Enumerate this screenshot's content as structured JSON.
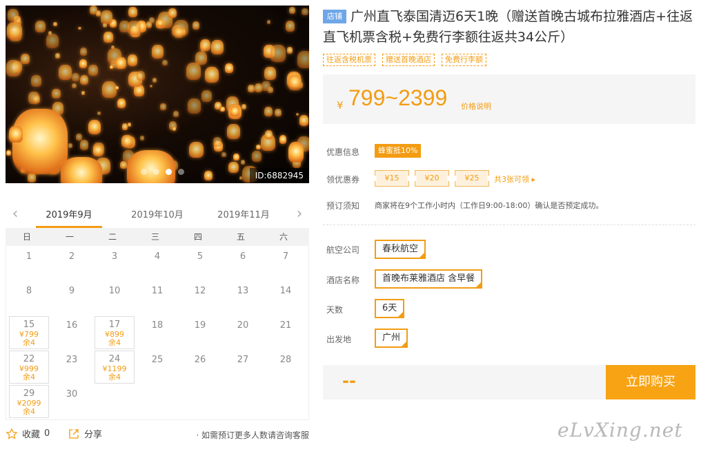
{
  "gallery": {
    "image_id": "ID:6882945",
    "dot_count": 4,
    "active_dot": 2
  },
  "calendar": {
    "prev_icon": "chevron-left-icon",
    "next_icon": "chevron-right-icon",
    "months": [
      "2019年9月",
      "2019年10月",
      "2019年11月"
    ],
    "active_month": 0,
    "weekdays": [
      "日",
      "一",
      "二",
      "三",
      "四",
      "五",
      "六"
    ],
    "start_weekday": 0,
    "days_in_month": 30,
    "available": [
      {
        "day": "15",
        "price": "¥799",
        "stock": "余4"
      },
      {
        "day": "17",
        "price": "¥899",
        "stock": "余4"
      },
      {
        "day": "22",
        "price": "¥999",
        "stock": "余4"
      },
      {
        "day": "24",
        "price": "¥1199",
        "stock": "余4"
      },
      {
        "day": "29",
        "price": "¥2099",
        "stock": "余4"
      }
    ]
  },
  "actions": {
    "favorite_label": "收藏",
    "favorite_count": "0",
    "share_label": "分享",
    "consult_text": "· 如需预订更多人数请咨询客服"
  },
  "product": {
    "shop_tag": "店铺",
    "title": "广州直飞泰国清迈6天1晚（赠送首晚古城布拉雅酒店+往返直飞机票含税+免费行李额往返共34公斤）",
    "tags": [
      "往返含税机票",
      "赠送首晚酒店",
      "免费行李额"
    ],
    "price_currency": "¥",
    "price_range": "799~2399",
    "price_note": "价格说明"
  },
  "promotions": {
    "discount_label": "优惠信息",
    "discount_badge": "蜂蜜抵10%",
    "coupon_label": "领优惠券",
    "coupons": [
      "¥15",
      "¥20",
      "¥25"
    ],
    "coupon_more": "共3张可领 ▸",
    "notice_label": "预订须知",
    "notice_text": "商家将在9个工作小时内（工作日9:00-18:00）确认是否预定成功。"
  },
  "options": {
    "airline_label": "航空公司",
    "airline_value": "春秋航空",
    "hotel_label": "酒店名称",
    "hotel_value": "首晚布莱雅酒店 含早餐",
    "days_label": "天数",
    "days_value": "6天",
    "departure_label": "出发地",
    "departure_value": "广州"
  },
  "purchase": {
    "total_placeholder": "--",
    "buy_label": "立即购买"
  },
  "watermark": "eLvXing.net",
  "colors": {
    "accent": "#f39c12",
    "shop_tag": "#6ea6e8",
    "buy_button": "#f7a314"
  }
}
